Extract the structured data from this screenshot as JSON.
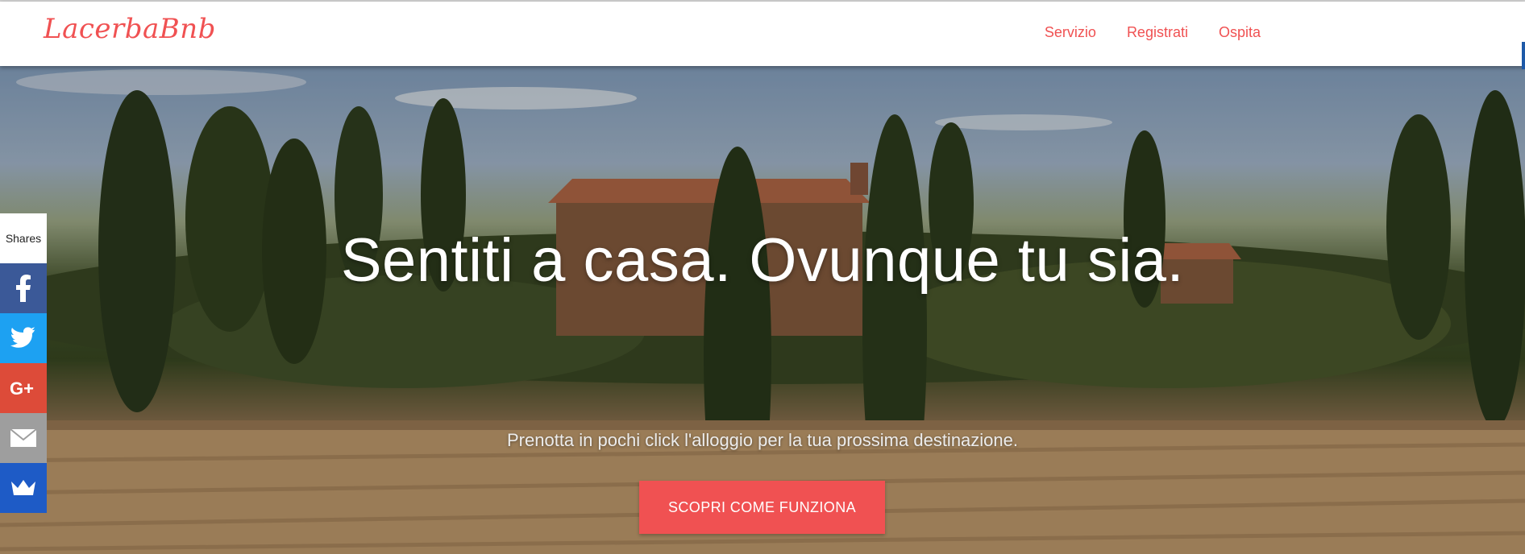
{
  "brand": {
    "logo_text": "LacerbaBnb",
    "accent_color": "#f05152"
  },
  "nav": {
    "items": [
      {
        "label": "Servizio"
      },
      {
        "label": "Registrati"
      },
      {
        "label": "Ospita"
      }
    ]
  },
  "hero": {
    "title": "Sentiti a casa. Ovunque tu sia.",
    "subtitle": "Prenotta in pochi click l'alloggio per la tua prossima destinazione.",
    "cta_label": "SCOPRI COME FUNZIONA"
  },
  "share_bar": {
    "label": "Shares",
    "buttons": [
      {
        "icon": "facebook-icon",
        "color": "#3b5998"
      },
      {
        "icon": "twitter-icon",
        "color": "#1da1f2"
      },
      {
        "icon": "google-plus-icon",
        "color": "#dd4b39"
      },
      {
        "icon": "email-icon",
        "color": "#9e9e9e"
      },
      {
        "icon": "crown-icon",
        "color": "#1e5bc6"
      }
    ]
  }
}
